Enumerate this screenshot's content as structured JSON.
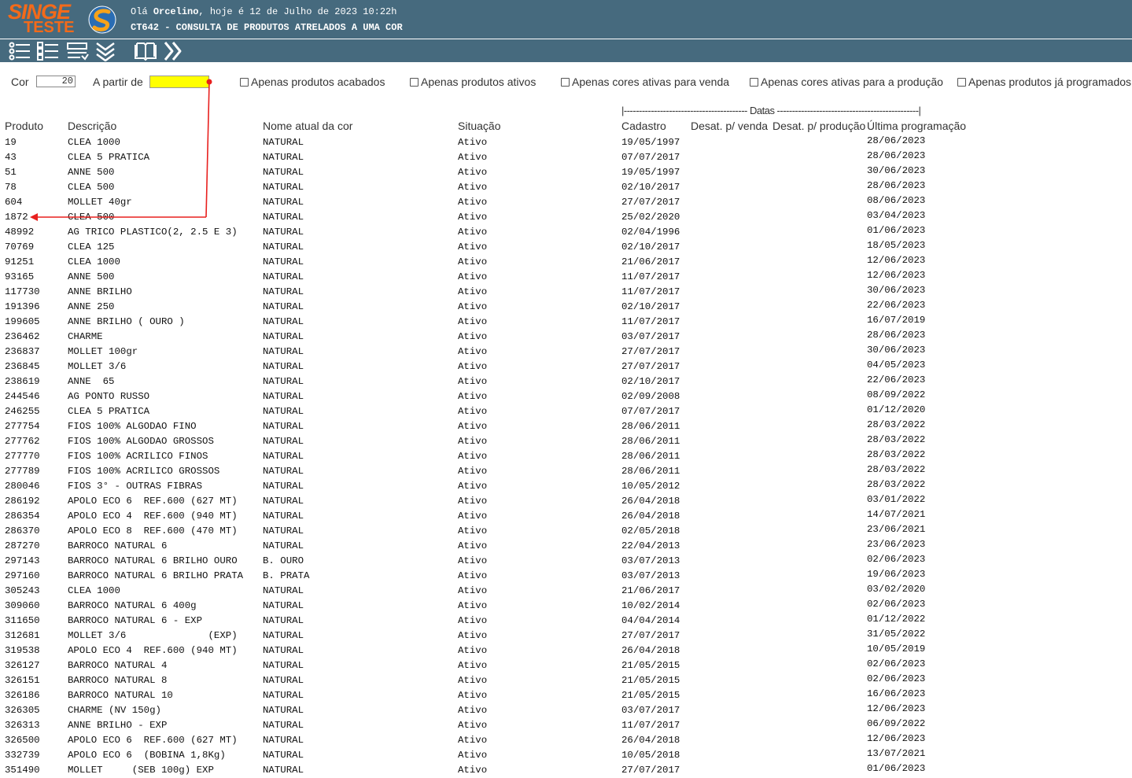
{
  "header": {
    "logo_line1": "SINGE",
    "logo_line2": "TESTE",
    "greeting_prefix": "Olá ",
    "user": "Orcelino",
    "greeting_suffix": ", hoje é 12 de Julho de 2023 10:22h",
    "screen_title": "CT642 - CONSULTA DE PRODUTOS ATRELADOS A UMA COR"
  },
  "toolbar": {
    "buttons": [
      "list-icon",
      "checklist-icon",
      "form-icon",
      "expand-all-icon",
      "manual-book-icon",
      "next-icon"
    ]
  },
  "filters": {
    "cor_label": "Cor",
    "cor_value": "20",
    "apartir_label": "A partir de",
    "apartir_value": "",
    "checkboxes": [
      {
        "label": "Apenas produtos acabados",
        "checked": false
      },
      {
        "label": "Apenas produtos ativos",
        "checked": false
      },
      {
        "label": "Apenas cores ativas para venda",
        "checked": false
      },
      {
        "label": "Apenas cores ativas para a produção",
        "checked": false
      },
      {
        "label": "Apenas produtos já programados",
        "checked": false
      }
    ]
  },
  "table": {
    "datas_group": "|----------------------------------------- Datas -----------------------------------------------|",
    "columns": {
      "produto": "Produto",
      "descricao": "Descrição",
      "nome_cor": "Nome atual da cor",
      "situacao": "Situação",
      "cadastro": "Cadastro",
      "desat_venda": "Desat. p/ venda",
      "desat_producao": "Desat. p/ produção",
      "ultima_prog": "Última programação"
    },
    "rows": [
      [
        "19",
        "CLEA 1000",
        "NATURAL",
        "Ativo",
        "19/05/1997",
        "28/06/2023"
      ],
      [
        "43",
        "CLEA 5 PRATICA",
        "NATURAL",
        "Ativo",
        "07/07/2017",
        "28/06/2023"
      ],
      [
        "51",
        "ANNE 500",
        "NATURAL",
        "Ativo",
        "19/05/1997",
        "30/06/2023"
      ],
      [
        "78",
        "CLEA 500",
        "NATURAL",
        "Ativo",
        "02/10/2017",
        "28/06/2023"
      ],
      [
        "604",
        "MOLLET 40gr",
        "NATURAL",
        "Ativo",
        "27/07/2017",
        "08/06/2023"
      ],
      [
        "1872",
        "CLEA 500",
        "NATURAL",
        "Ativo",
        "25/02/2020",
        "03/04/2023"
      ],
      [
        "48992",
        "AG TRICO PLASTICO(2, 2.5 E 3)",
        "NATURAL",
        "Ativo",
        "02/04/1996",
        "01/06/2023"
      ],
      [
        "70769",
        "CLEA 125",
        "NATURAL",
        "Ativo",
        "02/10/2017",
        "18/05/2023"
      ],
      [
        "91251",
        "CLEA 1000",
        "NATURAL",
        "Ativo",
        "21/06/2017",
        "12/06/2023"
      ],
      [
        "93165",
        "ANNE 500",
        "NATURAL",
        "Ativo",
        "11/07/2017",
        "12/06/2023"
      ],
      [
        "117730",
        "ANNE BRILHO",
        "NATURAL",
        "Ativo",
        "11/07/2017",
        "30/06/2023"
      ],
      [
        "191396",
        "ANNE 250",
        "NATURAL",
        "Ativo",
        "02/10/2017",
        "22/06/2023"
      ],
      [
        "199605",
        "ANNE BRILHO ( OURO )",
        "NATURAL",
        "Ativo",
        "11/07/2017",
        "16/07/2019"
      ],
      [
        "236462",
        "CHARME",
        "NATURAL",
        "Ativo",
        "03/07/2017",
        "28/06/2023"
      ],
      [
        "236837",
        "MOLLET 100gr",
        "NATURAL",
        "Ativo",
        "27/07/2017",
        "30/06/2023"
      ],
      [
        "236845",
        "MOLLET 3/6",
        "NATURAL",
        "Ativo",
        "27/07/2017",
        "04/05/2023"
      ],
      [
        "238619",
        "ANNE  65",
        "NATURAL",
        "Ativo",
        "02/10/2017",
        "22/06/2023"
      ],
      [
        "244546",
        "AG PONTO RUSSO",
        "NATURAL",
        "Ativo",
        "02/09/2008",
        "08/09/2022"
      ],
      [
        "246255",
        "CLEA 5 PRATICA",
        "NATURAL",
        "Ativo",
        "07/07/2017",
        "01/12/2020"
      ],
      [
        "277754",
        "FIOS 100% ALGODAO FINO",
        "NATURAL",
        "Ativo",
        "28/06/2011",
        "28/03/2022"
      ],
      [
        "277762",
        "FIOS 100% ALGODAO GROSSOS",
        "NATURAL",
        "Ativo",
        "28/06/2011",
        "28/03/2022"
      ],
      [
        "277770",
        "FIOS 100% ACRILICO FINOS",
        "NATURAL",
        "Ativo",
        "28/06/2011",
        "28/03/2022"
      ],
      [
        "277789",
        "FIOS 100% ACRILICO GROSSOS",
        "NATURAL",
        "Ativo",
        "28/06/2011",
        "28/03/2022"
      ],
      [
        "280046",
        "FIOS 3° - OUTRAS FIBRAS",
        "NATURAL",
        "Ativo",
        "10/05/2012",
        "28/03/2022"
      ],
      [
        "286192",
        "APOLO ECO 6  REF.600 (627 MT)",
        "NATURAL",
        "Ativo",
        "26/04/2018",
        "03/01/2022"
      ],
      [
        "286354",
        "APOLO ECO 4  REF.600 (940 MT)",
        "NATURAL",
        "Ativo",
        "26/04/2018",
        "14/07/2021"
      ],
      [
        "286370",
        "APOLO ECO 8  REF.600 (470 MT)",
        "NATURAL",
        "Ativo",
        "02/05/2018",
        "23/06/2021"
      ],
      [
        "287270",
        "BARROCO NATURAL 6",
        "NATURAL",
        "Ativo",
        "22/04/2013",
        "23/06/2023"
      ],
      [
        "297143",
        "BARROCO NATURAL 6 BRILHO OURO",
        "B. OURO",
        "Ativo",
        "03/07/2013",
        "02/06/2023"
      ],
      [
        "297160",
        "BARROCO NATURAL 6 BRILHO PRATA",
        "B. PRATA",
        "Ativo",
        "03/07/2013",
        "19/06/2023"
      ],
      [
        "305243",
        "CLEA 1000",
        "NATURAL",
        "Ativo",
        "21/06/2017",
        "03/02/2020"
      ],
      [
        "309060",
        "BARROCO NATURAL 6 400g",
        "NATURAL",
        "Ativo",
        "10/02/2014",
        "02/06/2023"
      ],
      [
        "311650",
        "BARROCO NATURAL 6 - EXP",
        "NATURAL",
        "Ativo",
        "04/04/2014",
        "01/12/2022"
      ],
      [
        "312681",
        "MOLLET 3/6              (EXP)",
        "NATURAL",
        "Ativo",
        "27/07/2017",
        "31/05/2022"
      ],
      [
        "319538",
        "APOLO ECO 4  REF.600 (940 MT)",
        "NATURAL",
        "Ativo",
        "26/04/2018",
        "10/05/2019"
      ],
      [
        "326127",
        "BARROCO NATURAL 4",
        "NATURAL",
        "Ativo",
        "21/05/2015",
        "02/06/2023"
      ],
      [
        "326151",
        "BARROCO NATURAL 8",
        "NATURAL",
        "Ativo",
        "21/05/2015",
        "02/06/2023"
      ],
      [
        "326186",
        "BARROCO NATURAL 10",
        "NATURAL",
        "Ativo",
        "21/05/2015",
        "16/06/2023"
      ],
      [
        "326305",
        "CHARME (NV 150g)",
        "NATURAL",
        "Ativo",
        "03/07/2017",
        "12/06/2023"
      ],
      [
        "326313",
        "ANNE BRILHO - EXP",
        "NATURAL",
        "Ativo",
        "11/07/2017",
        "06/09/2022"
      ],
      [
        "326500",
        "APOLO ECO 6  REF.600 (627 MT)",
        "NATURAL",
        "Ativo",
        "26/04/2018",
        "12/06/2023"
      ],
      [
        "332739",
        "APOLO ECO 6  (BOBINA 1,8Kg)",
        "NATURAL",
        "Ativo",
        "10/05/2018",
        "13/07/2021"
      ],
      [
        "351490",
        "MOLLET     (SEB 100g) EXP",
        "NATURAL",
        "Ativo",
        "27/07/2017",
        "01/06/2023"
      ]
    ]
  },
  "colors": {
    "header_bg": "#466a7e",
    "logo_orange": "#f36a1a",
    "highlight_input": "#ffff00",
    "annotation_red": "#e8201e"
  }
}
